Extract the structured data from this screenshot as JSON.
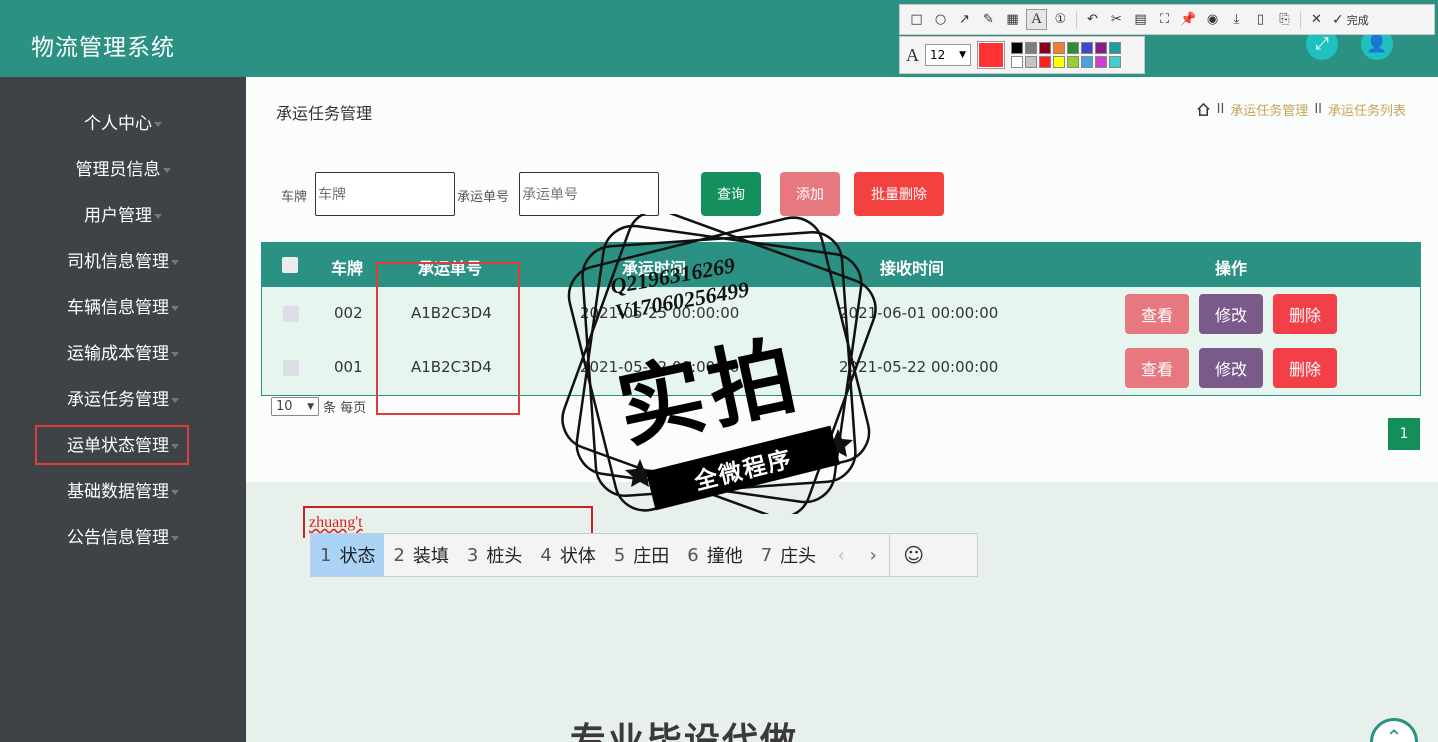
{
  "app": {
    "title": "物流管理系统"
  },
  "header_buttons": [
    {
      "icon": "expand-icon"
    },
    {
      "icon": "user-icon"
    }
  ],
  "snip_toolbar": {
    "tools": [
      "rectangle-icon",
      "circle-icon",
      "arrow-icon",
      "pen-icon",
      "mosaic-icon",
      "text-icon",
      "serial-number-icon",
      "undo-icon",
      "crop-icon",
      "ocr-icon",
      "scan-icon",
      "pin-icon",
      "record-icon",
      "download-icon",
      "copy-icon",
      "save-icon",
      "close-icon"
    ],
    "done_label": "完成",
    "font_size": "12",
    "current_color": "#ff3333",
    "palette": [
      "#000000",
      "#7f7f7f",
      "#880015",
      "#f08030",
      "#2e8b3a",
      "#3f48cc",
      "#8b1a8b",
      "#1e9ea0",
      "#ffffff",
      "#c3c3c3",
      "#ff2020",
      "#ffff00",
      "#9acd32",
      "#4aa3df",
      "#d040d0",
      "#40d0d0"
    ]
  },
  "sidebar": {
    "items": [
      {
        "label": "个人中心"
      },
      {
        "label": "管理员信息"
      },
      {
        "label": "用户管理"
      },
      {
        "label": "司机信息管理"
      },
      {
        "label": "车辆信息管理"
      },
      {
        "label": "运输成本管理"
      },
      {
        "label": "承运任务管理"
      },
      {
        "label": "运单状态管理"
      },
      {
        "label": "基础数据管理"
      },
      {
        "label": "公告信息管理"
      }
    ]
  },
  "page": {
    "heading": "承运任务管理",
    "breadcrumb": [
      "承运任务管理",
      "承运任务列表"
    ],
    "breadcrumb_sep": "II"
  },
  "search": {
    "plate_label": "车牌",
    "plate_placeholder": "车牌",
    "order_label": "承运单号",
    "order_placeholder": "承运单号",
    "query_btn": "查询",
    "add_btn": "添加",
    "batch_delete_btn": "批量删除"
  },
  "table": {
    "columns": [
      "车牌",
      "承运单号",
      "承运时间",
      "接收时间",
      "操作"
    ],
    "rows": [
      {
        "plate": "002",
        "order_no": "A1B2C3D4",
        "carry_time": "2021-05-25 00:00:00",
        "receive_time": "2021-06-01 00:00:00"
      },
      {
        "plate": "001",
        "order_no": "A1B2C3D4",
        "carry_time": "2021-05-22 00:00:00",
        "receive_time": "2021-05-22 00:00:00"
      }
    ],
    "actions": {
      "view": "查看",
      "edit": "修改",
      "delete": "删除"
    }
  },
  "pagination": {
    "page_size": "10",
    "per_page_label": "条 每页",
    "current_page": "1"
  },
  "ime": {
    "composition": "zhuang't",
    "candidates": [
      {
        "n": "1",
        "text": "状态"
      },
      {
        "n": "2",
        "text": "装填"
      },
      {
        "n": "3",
        "text": "桩头"
      },
      {
        "n": "4",
        "text": "状体"
      },
      {
        "n": "5",
        "text": "庄田"
      },
      {
        "n": "6",
        "text": "撞他"
      },
      {
        "n": "7",
        "text": "庄头"
      }
    ],
    "prev": "‹",
    "next": "›",
    "emoji": "☺"
  },
  "watermark": {
    "line1": "Q2196316269",
    "line2": "V17060256499",
    "big": "实拍",
    "band": "全微程序"
  },
  "bottom_text": "专业毕设代做"
}
